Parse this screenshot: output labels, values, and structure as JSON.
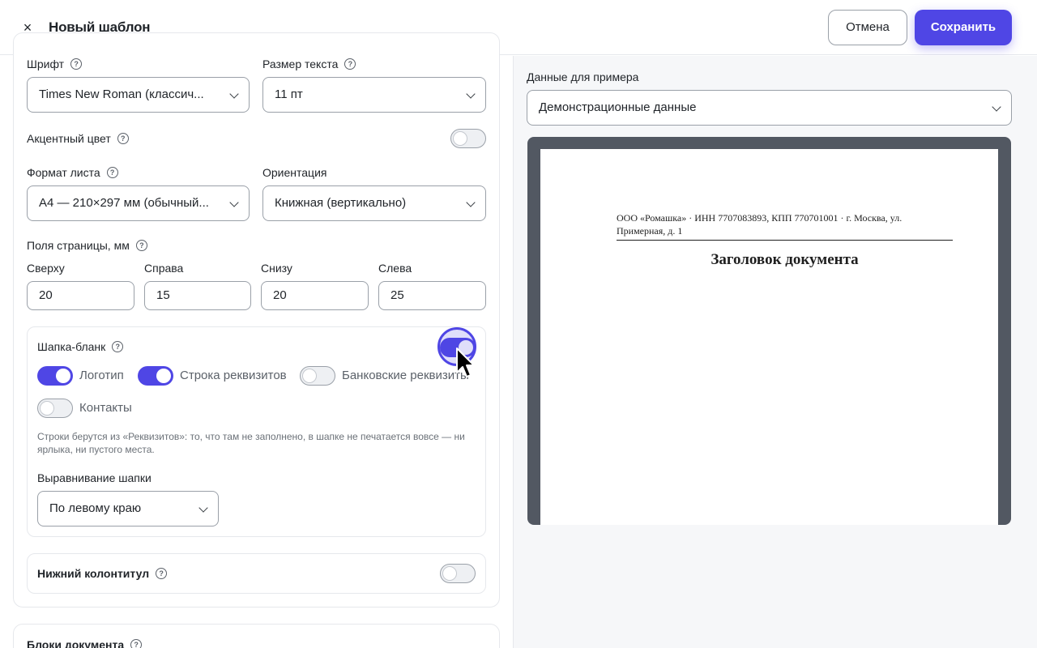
{
  "header": {
    "close_icon": "×",
    "title": "Новый шаблон",
    "cancel_label": "Отмена",
    "save_label": "Сохранить"
  },
  "form": {
    "font_label": "Шрифт",
    "font_value": "Times New Roman (классич...",
    "size_label": "Размер текста",
    "size_value": "11 пт",
    "accent_label": "Акцентный цвет",
    "accent_on": false,
    "format_label": "Формат листа",
    "format_value": "A4 — 210×297 мм (обычный...",
    "orientation_label": "Ориентация",
    "orientation_value": "Книжная (вертикально)",
    "margins_label": "Поля страницы, мм",
    "margins": [
      {
        "label": "Сверху",
        "value": "20"
      },
      {
        "label": "Справа",
        "value": "15"
      },
      {
        "label": "Снизу",
        "value": "20"
      },
      {
        "label": "Слева",
        "value": "25"
      }
    ]
  },
  "header_blank": {
    "label": "Шапка-бланк",
    "enabled": true,
    "options": [
      {
        "label": "Логотип",
        "on": true
      },
      {
        "label": "Строка реквизитов",
        "on": true
      },
      {
        "label": "Банковские реквизиты",
        "on": false
      },
      {
        "label": "Контакты",
        "on": false
      }
    ],
    "hint": "Строки берутся из «Реквизитов»: то, что там не заполнено, в шапке не печатается вовсе — ни ярлыка, ни пустого места.",
    "align_label": "Выравнивание шапки",
    "align_value": "По левому краю"
  },
  "footer": {
    "label": "Нижний колонтитул",
    "enabled": false
  },
  "blocks": {
    "label": "Блоки документа"
  },
  "preview": {
    "data_label": "Данные для примера",
    "data_value": "Демонстрационные данные",
    "doc_requisites": "ООО «Ромашка» · ИНН 7707083893, КПП 770701001 · г. Москва, ул. Примерная, д. 1",
    "doc_title": "Заголовок документа"
  },
  "colors": {
    "accent": "#4f46e5",
    "preview_bg": "#525862"
  }
}
